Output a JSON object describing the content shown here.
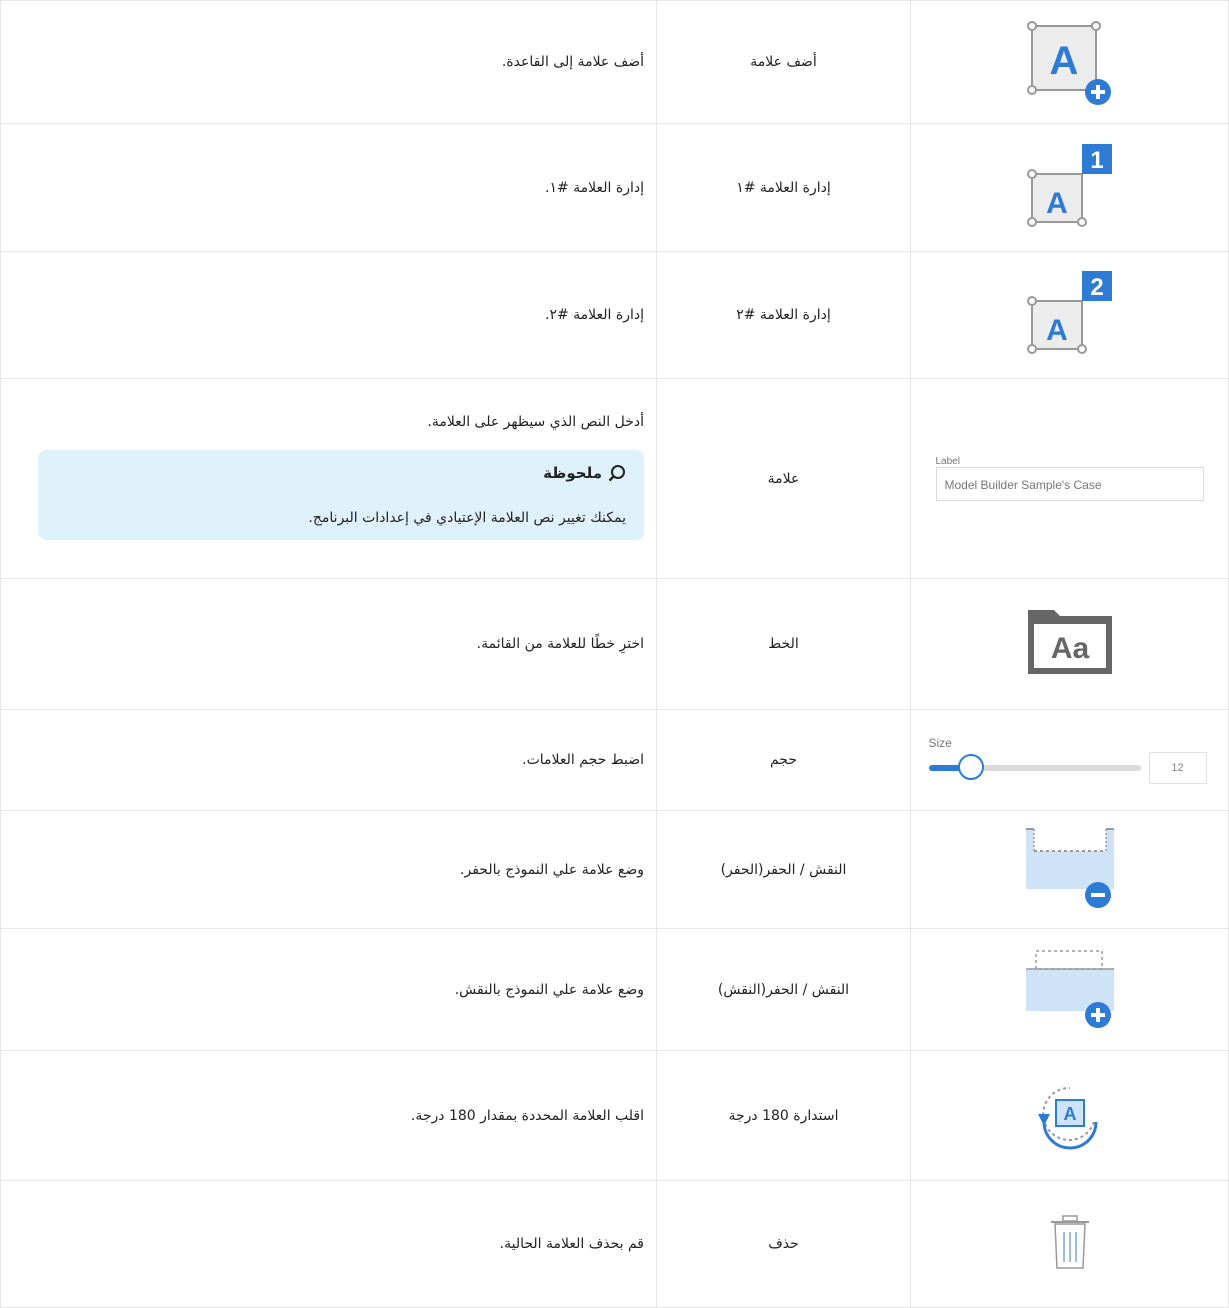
{
  "rows": [
    {
      "icon": "add-label-icon",
      "name": "أضف علامة",
      "desc": "أضف علامة إلى القاعدة."
    },
    {
      "icon": "manage-label-1-icon",
      "name": "إدارة العلامة #١",
      "desc": "إدارة العلامة #١.",
      "badge": "1"
    },
    {
      "icon": "manage-label-2-icon",
      "name": "إدارة العلامة #٢",
      "desc": "إدارة العلامة #٢.",
      "badge": "2"
    },
    {
      "icon": "label-field",
      "name": "علامة",
      "desc": "أدخل النص الذي سيظهر على العلامة.",
      "field_label": "Label",
      "field_value": "Model Builder Sample's Case",
      "note_title": "ملحوظة",
      "note_body": "يمكنك تغيير نص العلامة الإعتيادي في إعدادات البرنامج."
    },
    {
      "icon": "font-icon",
      "name": "الخط",
      "desc": "اخترِ خطًا للعلامة من القائمة.",
      "icon_text": "Aa"
    },
    {
      "icon": "size-slider",
      "name": "حجم",
      "desc": "اضبط حجم العلامات.",
      "size_label": "Size",
      "size_value": "12",
      "size_fraction": 0.2
    },
    {
      "icon": "engrave-icon",
      "name": "النقش / الحفر(الحفر)",
      "desc": "وضع علامة علي النموذج بالحفر."
    },
    {
      "icon": "emboss-icon",
      "name": "النقش / الحفر(النقش)",
      "desc": "وضع علامة علي النموذج بالنقش."
    },
    {
      "icon": "rotate-180-icon",
      "name": "استدارة 180 درجة",
      "desc": "اقلب العلامة المحددة بمقدار 180 درجة."
    },
    {
      "icon": "trash-icon",
      "name": "حذف",
      "desc": "قم بحذف العلامة الحالية."
    }
  ],
  "colors": {
    "accent": "#2e7bd6",
    "note_bg": "#dff2fb",
    "icon_gray": "#666666"
  }
}
